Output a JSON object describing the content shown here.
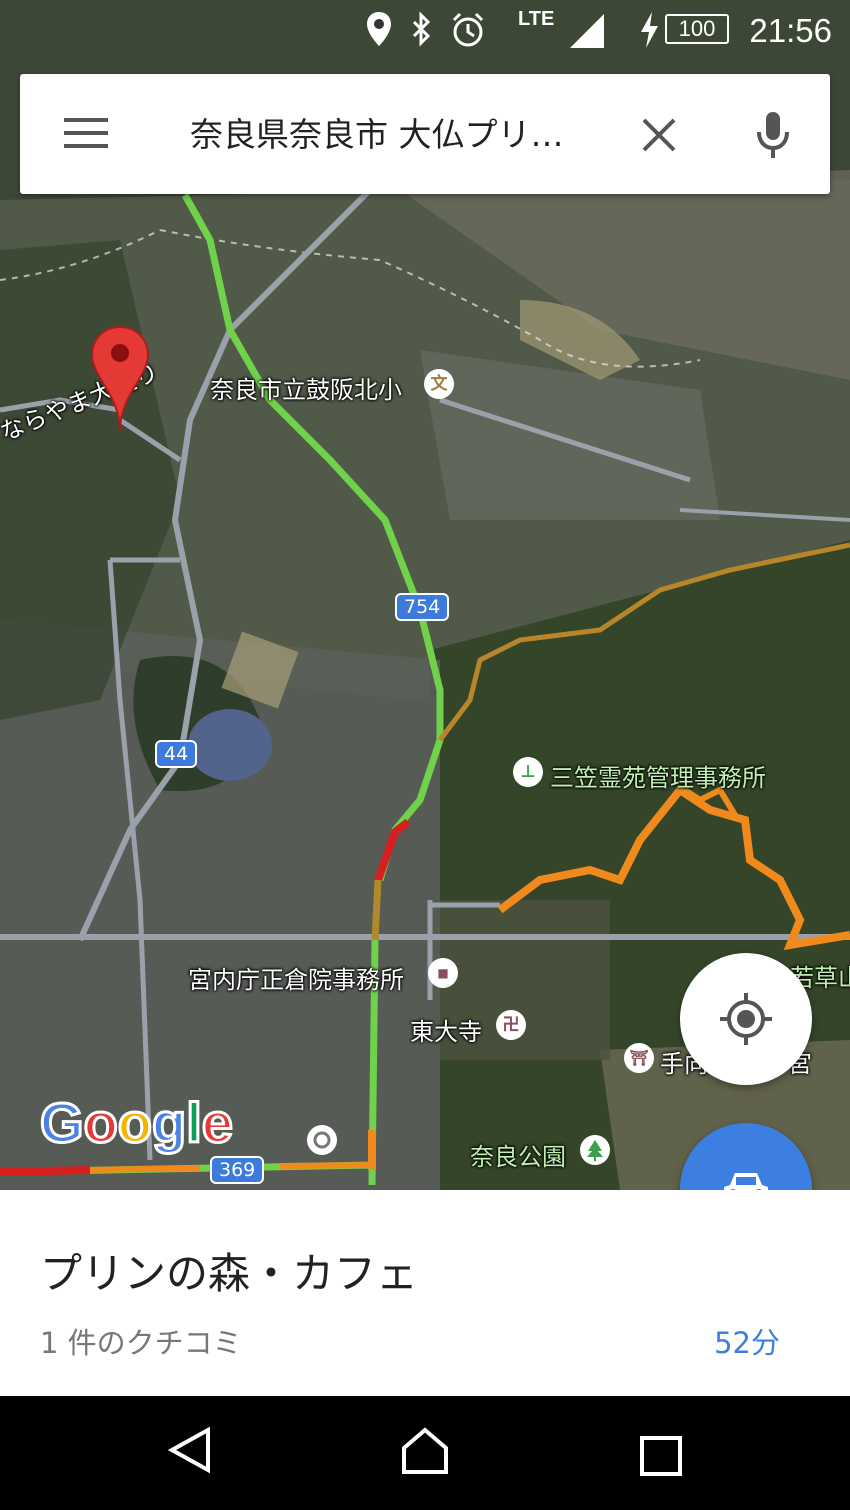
{
  "status_bar": {
    "network": "LTE",
    "battery": "100",
    "time": "21:56",
    "icons": [
      "location-icon",
      "bluetooth-icon",
      "alarm-icon",
      "signal-icon",
      "charging-icon",
      "battery-icon"
    ]
  },
  "search": {
    "menu_icon": "menu-icon",
    "query": "奈良県奈良市 大仏プリ…",
    "clear_icon": "close-icon",
    "voice_icon": "microphone-icon"
  },
  "map": {
    "labels": {
      "street_narayama": "ならやま大通り",
      "school": "奈良市立鼓阪北小",
      "cemetery": "三笠霊苑管理事務所",
      "shosoin": "宮内庁正倉院事務所",
      "todaiji": "東大寺",
      "wakakusa": "若草山",
      "tamukeyama_left": "手向",
      "tamukeyama_right": "宮",
      "nara_park": "奈良公園"
    },
    "route_shields": {
      "r754": "754",
      "r44": "44",
      "r369": "369"
    },
    "poi_icons": {
      "school": "文",
      "cemetery": "⊥",
      "shosoin": "■",
      "todaiji": "卍",
      "tamukeyama": "⛩",
      "park": "tree-icon"
    },
    "logo": "Google",
    "colors": {
      "traffic_green": "#6fd24a",
      "traffic_red": "#d62020",
      "traffic_orange": "#f08a1c",
      "pin": "#e53935"
    }
  },
  "place": {
    "title": "プリンの森・カフェ",
    "reviews": "1 件のクチコミ",
    "duration": "52分"
  },
  "nav_bar": {
    "icons": [
      "back-icon",
      "home-icon",
      "recents-icon"
    ]
  }
}
